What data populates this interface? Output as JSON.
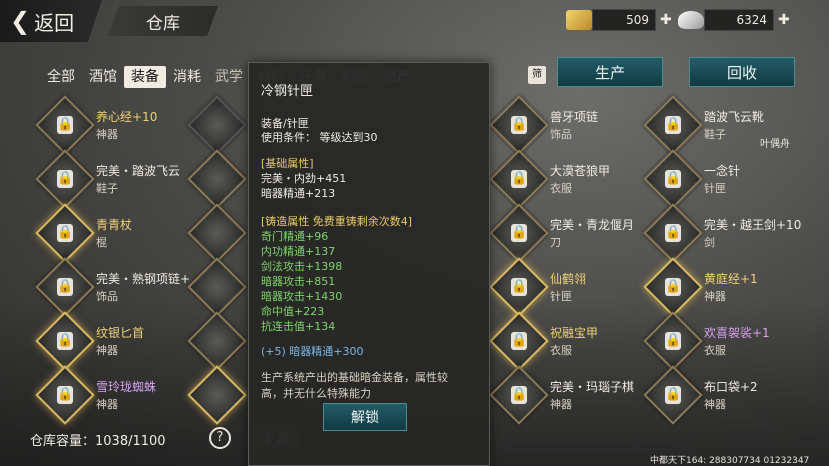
{
  "header": {
    "back_label": "返回",
    "title": "仓库",
    "gold": {
      "icon": "gold-ingot-icon",
      "amount": "509"
    },
    "silver": {
      "icon": "silver-ingot-icon",
      "amount": "6324"
    }
  },
  "tabs": [
    {
      "label": "全部",
      "active": false
    },
    {
      "label": "酒馆",
      "active": false
    },
    {
      "label": "装备",
      "active": true
    },
    {
      "label": "消耗",
      "active": false
    },
    {
      "label": "武学",
      "active": false
    },
    {
      "label": "材料",
      "active": false
    },
    {
      "label": "任务",
      "active": false
    },
    {
      "label": "刺绣",
      "active": false
    },
    {
      "label": "资产",
      "active": false
    }
  ],
  "filter_label": "筛",
  "buttons": {
    "produce": "生产",
    "recycle": "回收"
  },
  "items": [
    {
      "name": "养心经+10",
      "kind": "神器",
      "name_color": "gold"
    },
    {
      "name": "完美・踏波飞云",
      "kind": "鞋子",
      "name_color": "white"
    },
    {
      "name": "青青杖",
      "kind": "棍",
      "name_color": "gold"
    },
    {
      "name": "完美・熟钢项链+",
      "kind": "饰品",
      "name_color": "white"
    },
    {
      "name": "纹银匕首",
      "kind": "神器",
      "name_color": "gold"
    },
    {
      "name": "雪玲珑蜘蛛",
      "kind": "神器",
      "name_color": "purple"
    },
    {
      "name": "兽牙项链",
      "kind": "饰品",
      "name_color": "white"
    },
    {
      "name": "大漠苍狼甲",
      "kind": "衣服",
      "name_color": "white"
    },
    {
      "name": "完美・青龙偃月",
      "kind": "刀",
      "name_color": "white"
    },
    {
      "name": "仙鹤翎",
      "kind": "针匣",
      "name_color": "gold"
    },
    {
      "name": "祝融宝甲",
      "kind": "衣服",
      "name_color": "gold"
    },
    {
      "name": "完美・玛瑙子棋",
      "kind": "神器",
      "name_color": "white"
    },
    {
      "name": "踏波飞云靴",
      "kind": "鞋子",
      "name_color": "white"
    },
    {
      "name": "一念针",
      "kind": "针匣",
      "name_color": "white"
    },
    {
      "name": "完美・越王剑+10",
      "kind": "剑",
      "name_color": "white"
    },
    {
      "name": "黄庭经+1",
      "kind": "神器",
      "name_color": "gold"
    },
    {
      "name": "欢喜袈裟+1",
      "kind": "衣服",
      "name_color": "purple"
    },
    {
      "name": "布口袋+2",
      "kind": "神器",
      "name_color": "white"
    }
  ],
  "side_note": "叶偶舟",
  "capacity": "仓库容量：1038/1100",
  "expand_label": "扩容",
  "footer_id": "中都天下164: 288307734 01232347",
  "tooltip": {
    "title": "冷钢针匣",
    "category": "装备/针匣",
    "requirement": "使用条件：  等级达到30",
    "basic_header": "[基础属性]",
    "basic": [
      "完美・内劲+451",
      "暗器精通+213"
    ],
    "forge_header": "[铸造属性  免费重铸剩余次数4]",
    "forge": [
      "奇门精通+96",
      "内功精通+137",
      "剑法攻击+1398",
      "暗器攻击+851",
      "暗器攻击+1430",
      "命中值+223",
      "抗连击值+134"
    ],
    "bonus": "(+5) 暗器精通+300",
    "desc_1": "生产系统产出的基础暗金装备，属性较",
    "desc_2": "高，并无什么特殊能力",
    "unlock": "解锁"
  }
}
